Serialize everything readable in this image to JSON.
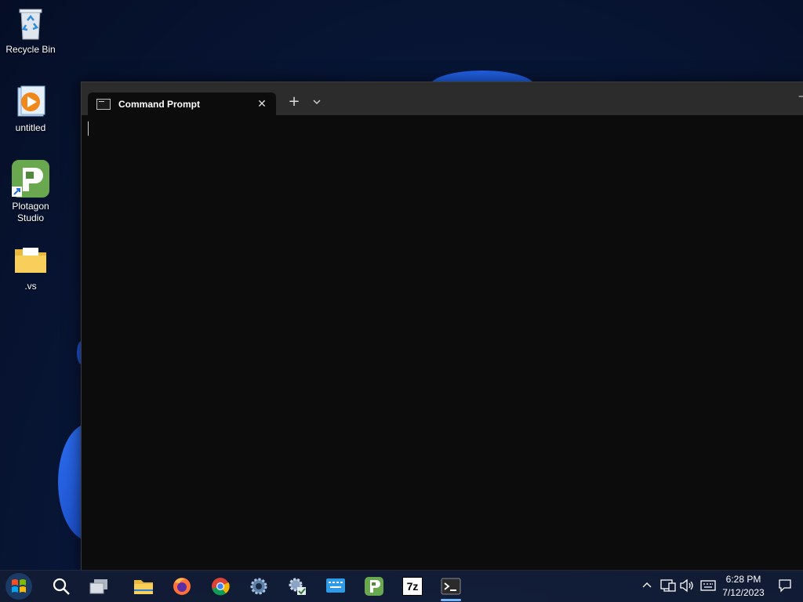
{
  "desktop": {
    "icons": [
      {
        "label": "Recycle Bin",
        "icon": "recycle-bin-icon"
      },
      {
        "label": "untitled",
        "icon": "media-player-file-icon"
      },
      {
        "label": "Plotagon Studio",
        "icon": "plotagon-studio-icon"
      },
      {
        "label": ".vs",
        "icon": "folder-icon"
      }
    ]
  },
  "terminal": {
    "tab_title": "Command Prompt",
    "tab_icon": "cmd-icon",
    "close_glyph": "✕",
    "new_tab_glyph": "+",
    "dropdown_glyph": "⌄",
    "minimize_glyph": "–",
    "background": "#0c0c0c",
    "titlebar_color": "#2c2c2c"
  },
  "taskbar": {
    "items": [
      {
        "name": "start",
        "icon": "windows-logo-icon"
      },
      {
        "name": "search",
        "icon": "search-icon"
      },
      {
        "name": "task-view",
        "icon": "task-view-icon"
      },
      {
        "name": "file-explorer",
        "icon": "folder-icon"
      },
      {
        "name": "firefox",
        "icon": "firefox-icon"
      },
      {
        "name": "chrome",
        "icon": "chrome-icon"
      },
      {
        "name": "settings",
        "icon": "gear-icon"
      },
      {
        "name": "control-panel",
        "icon": "settings-check-icon"
      },
      {
        "name": "on-screen-keyboard",
        "icon": "keyboard-app-icon"
      },
      {
        "name": "plotagon",
        "icon": "plotagon-studio-icon"
      },
      {
        "name": "7zip",
        "icon": "7zip-icon",
        "label": "7z"
      },
      {
        "name": "terminal",
        "icon": "terminal-icon",
        "active": true
      }
    ],
    "tray": {
      "chevron": "^",
      "time": "6:28 PM",
      "date": "7/12/2023"
    },
    "accent": "#6fb6ff"
  }
}
